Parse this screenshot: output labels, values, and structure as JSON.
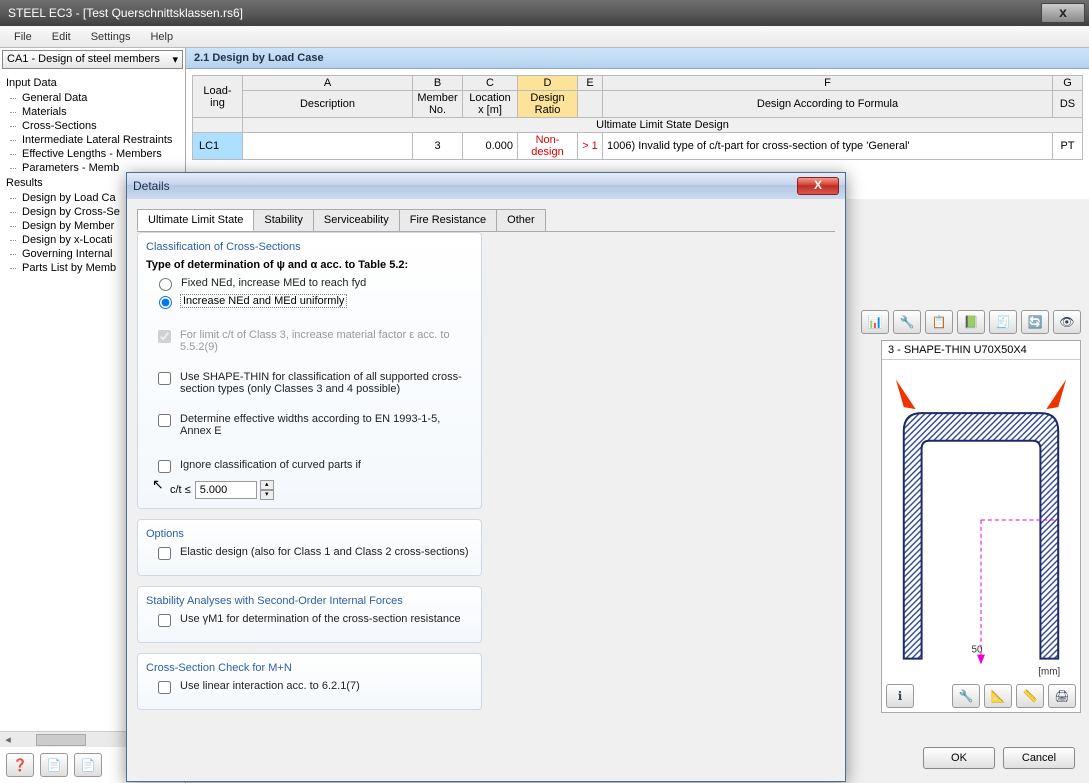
{
  "window": {
    "title": "STEEL EC3 - [Test Querschnittsklassen.rs6]"
  },
  "menu": [
    "File",
    "Edit",
    "Settings",
    "Help"
  ],
  "combo": {
    "value": "CA1 - Design of steel members"
  },
  "tree": {
    "input_label": "Input Data",
    "input_items": [
      "General Data",
      "Materials",
      "Cross-Sections",
      "Intermediate Lateral Restraints",
      "Effective Lengths - Members",
      "Parameters - Memb"
    ],
    "results_label": "Results",
    "results_items": [
      "Design by Load Ca",
      "Design by Cross-Se",
      "Design by Member",
      "Design by x-Locati",
      "Governing Internal",
      "Parts List by Memb"
    ]
  },
  "section_title": "2.1 Design by Load Case",
  "table": {
    "col_letters": [
      "A",
      "B",
      "C",
      "D",
      "E",
      "F",
      "G"
    ],
    "row_header": "Load-\ning",
    "headers": [
      "Description",
      "Member\nNo.",
      "Location\nx [m]",
      "Design\nRatio",
      "",
      "Design According to Formula",
      "DS"
    ],
    "group_label": "Ultimate Limit State Design",
    "row": {
      "lc": "LC1",
      "member": "3",
      "x": "0.000",
      "ratio": "Non-design",
      "gt": "> 1",
      "formula": "1006) Invalid type of c/t-part for cross-section of type 'General'",
      "ds": "PT"
    }
  },
  "preview": {
    "title": "3 - SHAPE-THIN U70X50X4",
    "axis_val": "50",
    "unit": "[mm]"
  },
  "dialog": {
    "title": "Details",
    "tabs": [
      "Ultimate Limit State",
      "Stability",
      "Serviceability",
      "Fire Resistance",
      "Other"
    ],
    "g1": {
      "title": "Classification of Cross-Sections",
      "subtitle": "Type of determination of ψ and α acc. to Table 5.2:",
      "r1": "Fixed NEd, increase MEd to reach fyd",
      "r2": "Increase NEd and MEd uniformly",
      "c1": "For limit c/t of Class 3, increase material factor ε acc. to 5.5.2(9)",
      "c2": "Use SHAPE-THIN for classification of all supported cross-section types (only Classes 3 and 4 possible)",
      "c3": "Determine effective widths according to EN 1993-1-5, Annex E",
      "c4": "Ignore classification of curved parts if",
      "ct_lbl": "c/t ≤",
      "ct_val": "5.000"
    },
    "g2": {
      "title": "Options",
      "c1": "Elastic design (also for Class 1 and Class 2 cross-sections)"
    },
    "g3": {
      "title": "Stability Analyses with Second-Order Internal Forces",
      "c1": "Use γM1 for determination of the cross-section resistance"
    },
    "g4": {
      "title": "Cross-Section Check for M+N",
      "c1": "Use linear interaction acc. to 6.2.1(7)"
    }
  },
  "buttons": {
    "ok": "OK",
    "cancel": "Cancel"
  }
}
